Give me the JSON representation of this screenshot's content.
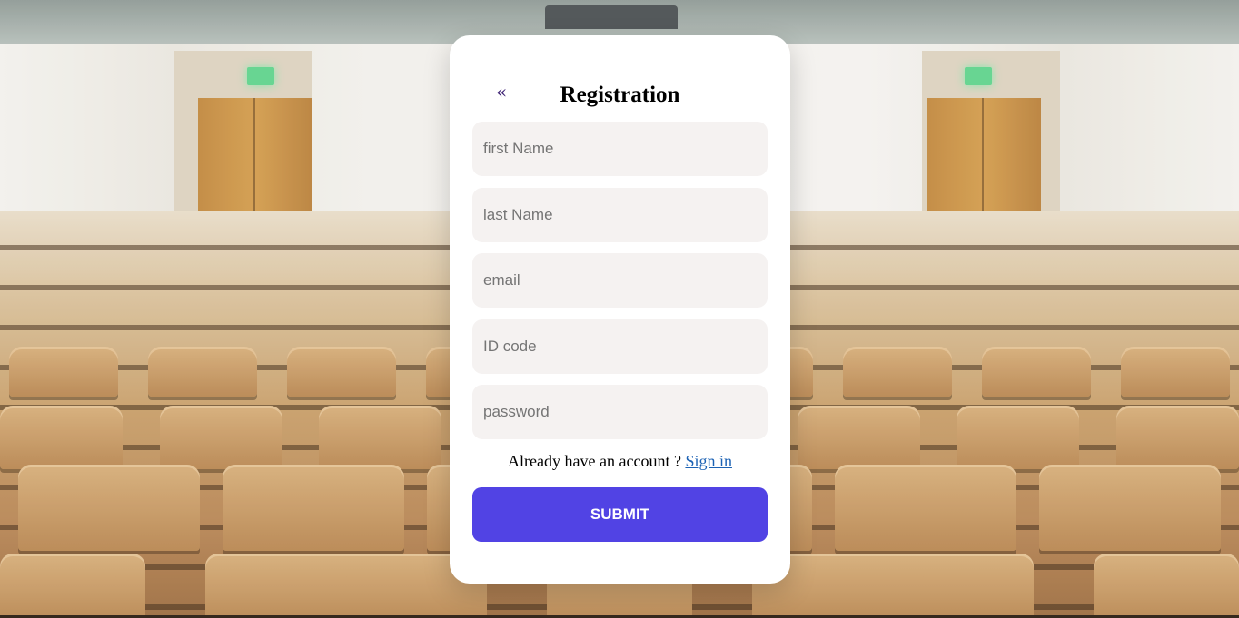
{
  "form": {
    "back_glyph": "«",
    "title": "Registration",
    "fields": [
      {
        "placeholder": "first Name",
        "value": ""
      },
      {
        "placeholder": "last Name",
        "value": ""
      },
      {
        "placeholder": "email",
        "value": ""
      },
      {
        "placeholder": "ID code",
        "value": ""
      },
      {
        "placeholder": "password",
        "value": ""
      }
    ],
    "signin_prompt": "Already have an account ?",
    "signin_link": "Sign in",
    "submit_label": "SUBMIT"
  },
  "colors": {
    "submit_bg": "#5143e4",
    "field_bg": "#f5f2f1",
    "link": "#1c62b4",
    "back_arrow": "#3b1f72"
  },
  "icons": {
    "back": "back-chevron-icon"
  }
}
